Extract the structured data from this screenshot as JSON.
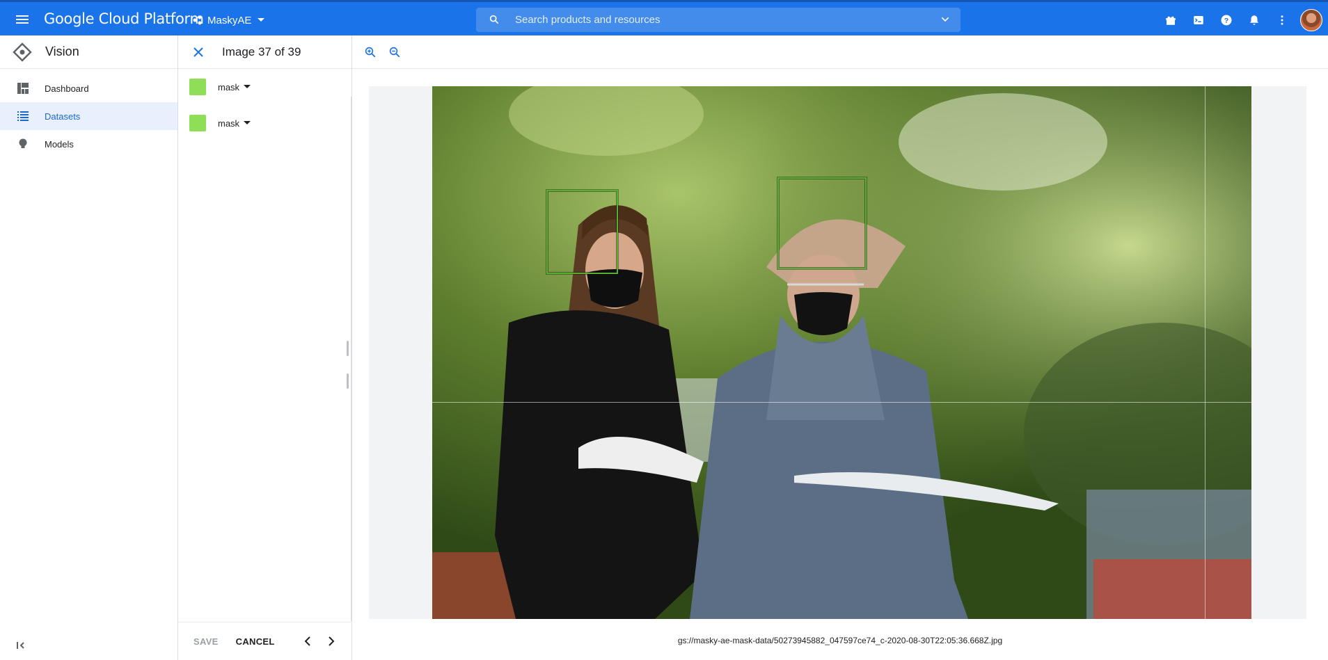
{
  "topbar": {
    "brand": "Google Cloud Platform",
    "project_name": "MaskyAE",
    "search_placeholder": "Search products and resources",
    "icons": [
      "gift-icon",
      "terminal-icon",
      "help-icon",
      "notifications-icon",
      "more-vert-icon",
      "account-avatar"
    ]
  },
  "colors": {
    "topbar_blue": "#1a73e8",
    "active_nav_bg": "#e8f0fe",
    "active_nav_text": "#1967d2",
    "label_color": "#8fde58",
    "bbox_color": "#57b030"
  },
  "sidebar": {
    "product": "Vision",
    "items": [
      {
        "label": "Dashboard",
        "icon": "dashboard-icon",
        "active": false
      },
      {
        "label": "Datasets",
        "icon": "list-icon",
        "active": true
      },
      {
        "label": "Models",
        "icon": "lightbulb-icon",
        "active": false
      }
    ]
  },
  "label_panel": {
    "title": "Image 37 of 39",
    "labels": [
      {
        "name": "mask"
      },
      {
        "name": "mask"
      }
    ],
    "save_label": "SAVE",
    "cancel_label": "CANCEL"
  },
  "viewer": {
    "file_path": "gs://masky-ae-mask-data/50273945882_047597ce74_c-2020-08-30T22:05:36.668Z.jpg",
    "image_description_icon": "photo-two-people-masks"
  }
}
